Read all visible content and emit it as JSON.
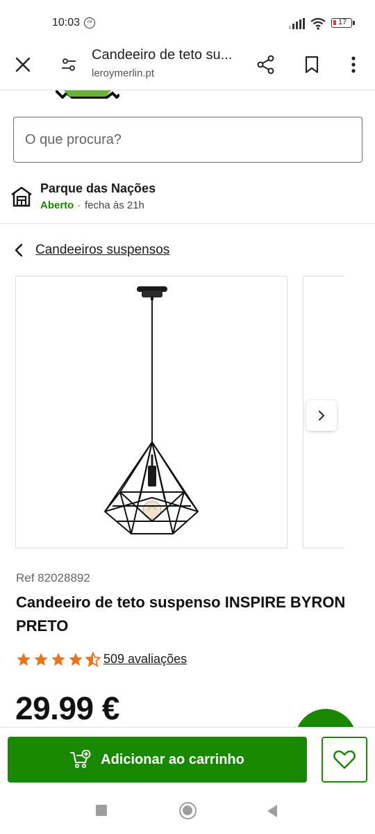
{
  "status_bar": {
    "time": "10:03",
    "mi_label": "mi",
    "battery": "17"
  },
  "browser": {
    "title": "Candeeiro de teto su...",
    "domain": "leroymerlin.pt"
  },
  "search": {
    "placeholder": "O que procura?"
  },
  "store": {
    "name": "Parque das Nações",
    "status": "Aberto",
    "separator": "·",
    "hours": "fecha às 21h"
  },
  "breadcrumb": {
    "label": "Candeeiros suspensos"
  },
  "product": {
    "ref": "Ref 82028892",
    "title": "Candeeiro de teto suspenso INSPIRE BYRON PRETO",
    "rating": 4.5,
    "rating_count": "509 avaliações",
    "price": "29.99 €"
  },
  "actions": {
    "add_to_cart": "Adicionar ao carrinho"
  },
  "colors": {
    "brand_green": "#188803",
    "star_orange": "#e8741e"
  },
  "icons": [
    "close-icon",
    "tune-icon",
    "share-icon",
    "bookmark-icon",
    "more-vert-icon",
    "store-icon",
    "chevron-left-icon",
    "chevron-right-icon",
    "star-icon",
    "cart-add-icon",
    "heart-icon"
  ]
}
